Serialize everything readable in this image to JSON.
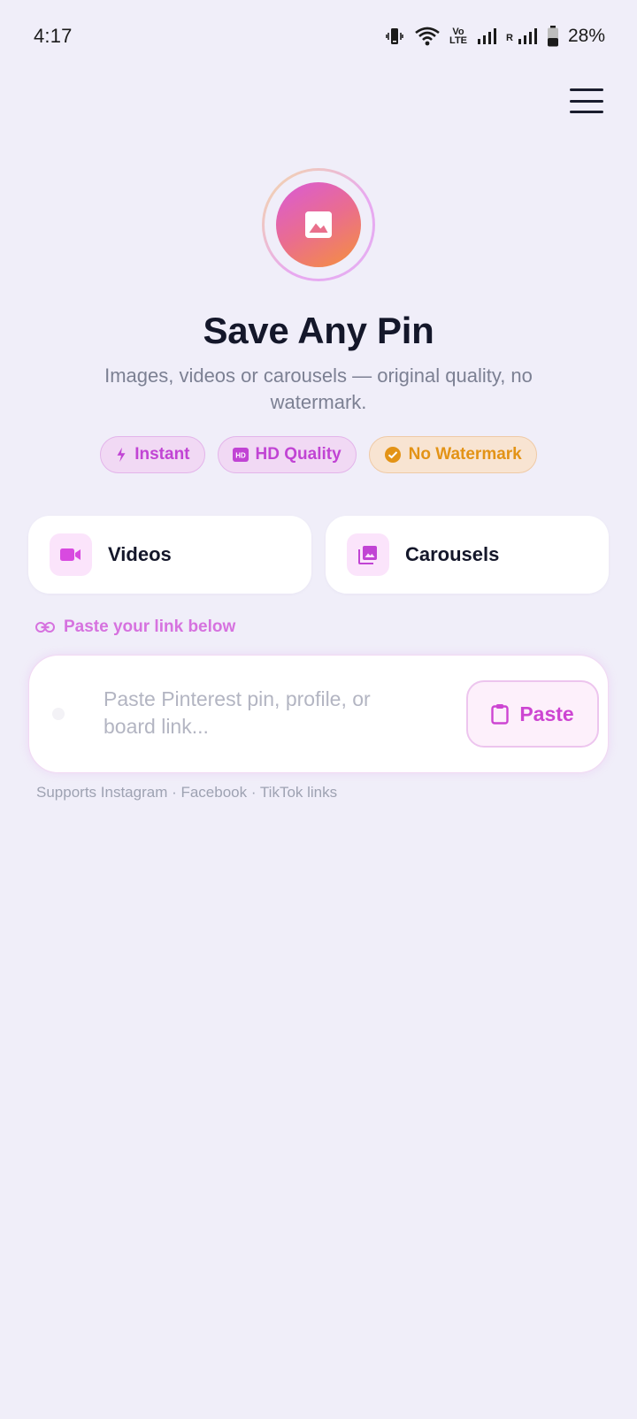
{
  "status_bar": {
    "time": "4:17",
    "battery_percent": "28%",
    "volte_top": "Vo",
    "volte_bottom": "LTE",
    "roaming_label": "R",
    "icons": [
      "vibrate-icon",
      "wifi-icon",
      "volte-icon",
      "signal-icon",
      "roaming-signal-icon",
      "battery-icon"
    ]
  },
  "header": {
    "menu_icon": "hamburger-menu-icon"
  },
  "hero": {
    "logo_icon": "image-icon",
    "title": "Save Any Pin",
    "subtitle": "Images, videos or carousels — original quality, no watermark."
  },
  "badges": [
    {
      "label": "Instant",
      "icon": "bolt-icon"
    },
    {
      "label": "HD Quality",
      "icon": "hd-icon"
    },
    {
      "label": "No Watermark",
      "icon": "check-circle-icon"
    }
  ],
  "cards": [
    {
      "label": "Videos",
      "icon": "video-camera-icon"
    },
    {
      "label": "Carousels",
      "icon": "photo-library-icon"
    }
  ],
  "paste_section": {
    "hint": "Paste your link below",
    "hint_icon": "link-icon",
    "input_value": "",
    "input_placeholder": "Paste Pinterest pin, profile, or board link...",
    "paste_button_label": "Paste",
    "paste_button_icon": "clipboard-icon",
    "supports_text": "Supports Instagram · Facebook · TikTok links"
  },
  "colors": {
    "background": "#f0eef9",
    "accent_purple": "#cd45d2",
    "accent_orange": "#e39316",
    "title": "#14172a",
    "muted": "#7c8093"
  }
}
